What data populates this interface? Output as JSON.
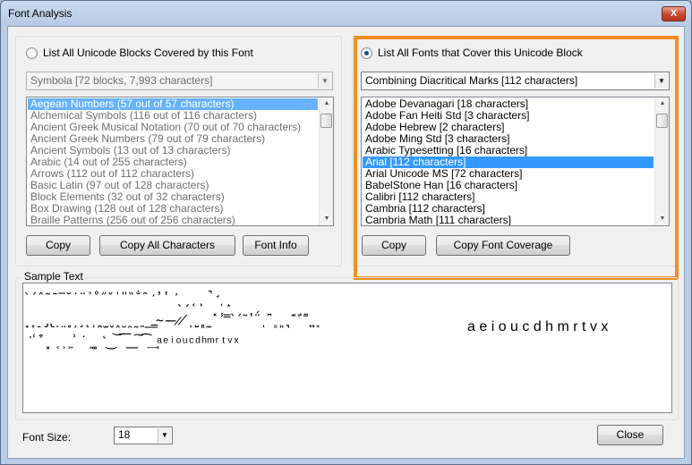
{
  "window": {
    "title": "Font Analysis",
    "close_glyph": "X"
  },
  "left_panel": {
    "radio_label": "List All Unicode Blocks Covered by this Font",
    "radio_checked": false,
    "font_combo_value": "Symbola [72 blocks, 7,993 characters]",
    "blocks": [
      "Aegean Numbers (57 out of 57 characters)",
      "Alchemical Symbols (116 out of 116 characters)",
      "Ancient Greek Musical Notation (70 out of 70 characters)",
      "Ancient Greek Numbers (79 out of 79 characters)",
      "Ancient Symbols (13 out of 13 characters)",
      "Arabic (14 out of 255 characters)",
      "Arrows (112 out of 112 characters)",
      "Basic Latin (97 out of 128 characters)",
      "Block Elements (32 out of 32 characters)",
      "Box Drawing (128 out of 128 characters)",
      "Braille Patterns (256 out of 256 characters)"
    ],
    "selected_index": 0,
    "buttons": {
      "copy": "Copy",
      "copy_all": "Copy All Characters",
      "font_info": "Font Info"
    }
  },
  "right_panel": {
    "radio_label": "List All Fonts that Cover this Unicode Block",
    "radio_checked": true,
    "block_combo_value": "Combining Diacritical Marks [112 characters]",
    "fonts": [
      "Adobe Devanagari [18 characters]",
      "Adobe Fan Heiti Std [3 characters]",
      "Adobe Hebrew [2 characters]",
      "Adobe Ming Std [3 characters]",
      "Arabic Typesetting [16 characters]",
      "Arial [112 characters]",
      "Arial Unicode MS [72 characters]",
      "BabelStone Han [16 characters]",
      "Calibri [112 characters]",
      "Cambria [112 characters]",
      "Cambria Math [111 characters]"
    ],
    "selected_index": 5,
    "buttons": {
      "copy": "Copy",
      "copy_coverage": "Copy Font Coverage"
    },
    "highlight_color": "#f28e1e"
  },
  "sample": {
    "label": "Sample Text",
    "lines": [
      "̀ ́ ̂ ̃ ̄ ̅ ̆ ̇ ̈ ̉ ̊ ̋ ̌ ̍ ̎ ̏ ̐ ̑ ̒ ̓ ̔ ̕ ̖ ̗ ̘ ̙ ̚ ̛ ̜ ̝",
      "̞ ̟ ̠ ̡ ̢ ̣ ̤ ̥ ̦ ̧ ̨ ̩ ̪ ̫ ̬ ̭ ̮ ̯ ̰ ̱ ̲ ̳ ̴ ̵ ̶ ̷ ̸ ̹ ̺ ̻ ̼ ̽ ̾ ̿ ̀ ́ ͂ ̓ ̈́ ͅ ͆ ͇ ͈ ͉ ͊ ͋ ͌ ͍ ͎ ͏",
      "͐ ͑ ͒ ͓ ͔ ͕ ͖ ͗ ͘ ͙ ͚ ͛ ͜ ͝ ͞ ͟ ͠ ͡ ͢ ͣ ͤ ͥ ͦ ͧ ͨ ͩ ͪ ͫ ͬ ͭ ͮ ͯ",
      "a e i o u c d h m r t v x"
    ]
  },
  "footer": {
    "font_size_label": "Font Size:",
    "font_size_value": "18",
    "close_label": "Close"
  }
}
